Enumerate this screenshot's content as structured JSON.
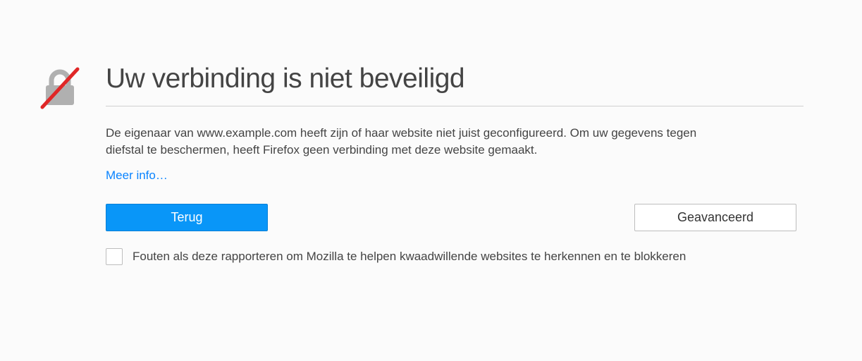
{
  "title": "Uw verbinding is niet beveiligd",
  "body": "De eigenaar van www.example.com heeft zijn of haar website niet juist geconfigureerd. Om uw gegevens tegen diefstal te beschermen, heeft Firefox geen verbinding met deze website gemaakt.",
  "more_info": "Meer info…",
  "buttons": {
    "back": "Terug",
    "advanced": "Geavanceerd"
  },
  "checkbox_label": "Fouten als deze rapporteren om Mozilla te helpen kwaadwillende websites te herkennen en te blokkeren"
}
